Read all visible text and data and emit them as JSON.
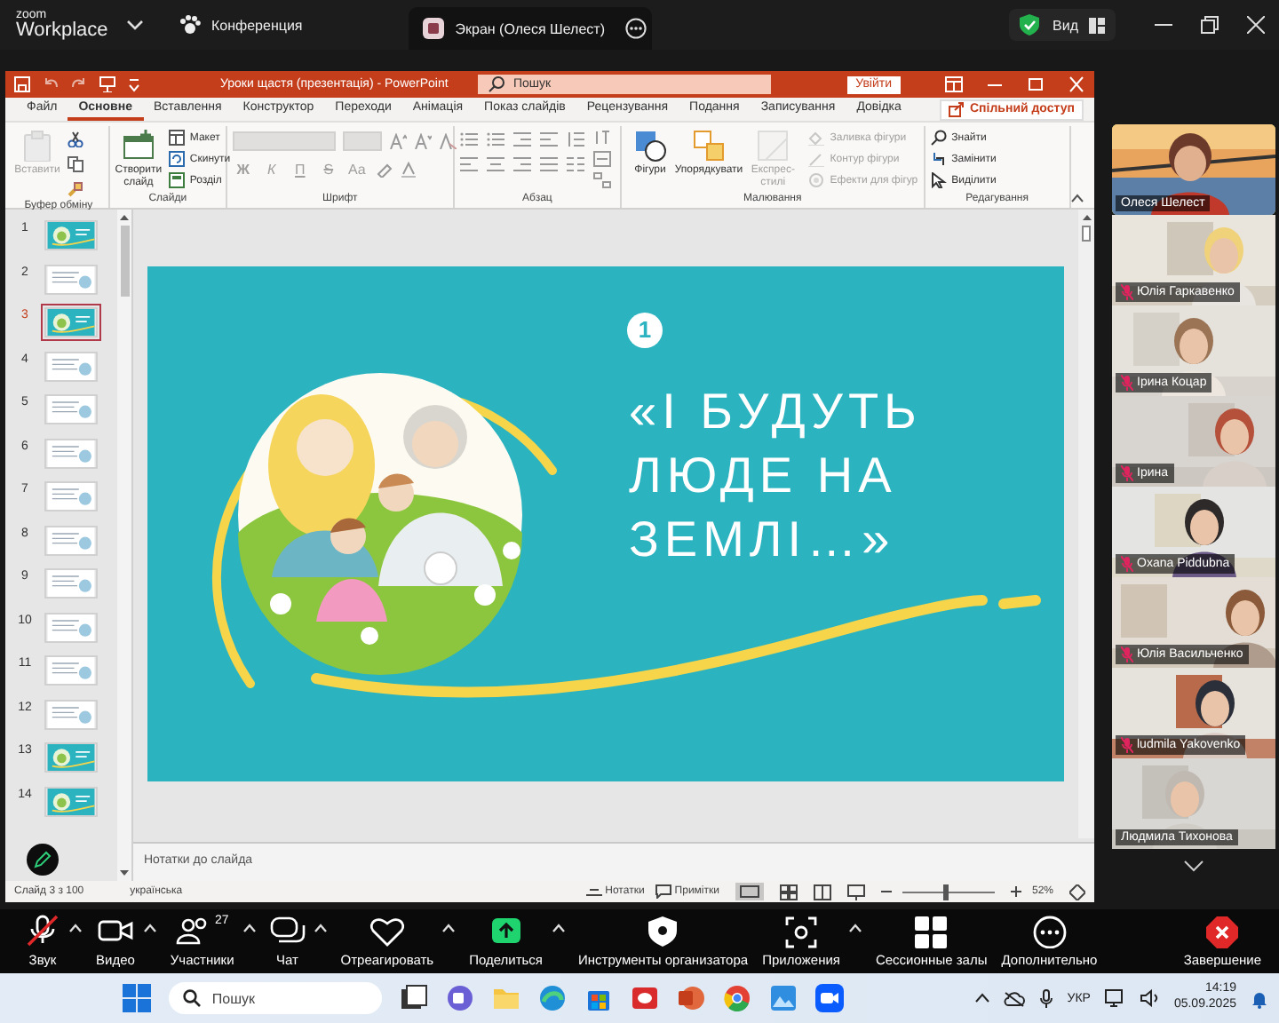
{
  "zoom_header": {
    "logo_top": "zoom",
    "logo_bottom": "Workplace",
    "meeting_tab": "Конференция",
    "share_tab": "Экран (Олеся Шелест)",
    "view_button": "Вид"
  },
  "powerpoint": {
    "title": "Уроки щастя (презентація)  -  PowerPoint",
    "search": {
      "placeholder": "Пошук"
    },
    "sign_in": "Увійти",
    "tabs": [
      {
        "label": "Файл",
        "selected": false
      },
      {
        "label": "Основне",
        "selected": true
      },
      {
        "label": "Вставлення",
        "selected": false
      },
      {
        "label": "Конструктор",
        "selected": false
      },
      {
        "label": "Переходи",
        "selected": false
      },
      {
        "label": "Анімація",
        "selected": false
      },
      {
        "label": "Показ слайдів",
        "selected": false
      },
      {
        "label": "Рецензування",
        "selected": false
      },
      {
        "label": "Подання",
        "selected": false
      },
      {
        "label": "Записування",
        "selected": false
      },
      {
        "label": "Довідка",
        "selected": false
      }
    ],
    "share_button": "Спільний доступ",
    "ribbon_groups": [
      {
        "label": "Буфер обміну",
        "buttons": [
          {
            "kind": "large",
            "label": "Вставити",
            "disabled": true
          }
        ]
      },
      {
        "label": "Слайди",
        "buttons": [
          {
            "kind": "large",
            "label": "Створити слайд",
            "disabled": false
          },
          {
            "kind": "small",
            "label": "Макет",
            "disabled": false
          },
          {
            "kind": "small",
            "label": "Скинути",
            "disabled": false
          },
          {
            "kind": "small",
            "label": "Розділ",
            "disabled": false
          }
        ]
      },
      {
        "label": "Шрифт",
        "buttons": [
          {
            "kind": "glyph",
            "label": "Ж",
            "disabled": true
          },
          {
            "kind": "glyph",
            "label": "К",
            "disabled": true
          },
          {
            "kind": "glyph",
            "label": "П",
            "disabled": true
          },
          {
            "kind": "glyph",
            "label": "S",
            "disabled": true
          },
          {
            "kind": "glyph",
            "label": "Aa",
            "disabled": true
          }
        ]
      },
      {
        "label": "Абзац"
      },
      {
        "label": "Малювання",
        "buttons": [
          {
            "kind": "large",
            "label": "Фігури",
            "disabled": false
          },
          {
            "kind": "large",
            "label": "Упорядкувати",
            "disabled": false
          },
          {
            "kind": "large",
            "label": "Експрес-стилі",
            "disabled": true
          },
          {
            "kind": "small",
            "label": "Заливка фігури",
            "disabled": true
          },
          {
            "kind": "small",
            "label": "Контур фігури",
            "disabled": true
          },
          {
            "kind": "small",
            "label": "Ефекти для фігур",
            "disabled": true
          }
        ]
      },
      {
        "label": "Редагування",
        "buttons": [
          {
            "kind": "small",
            "label": "Знайти",
            "disabled": false
          },
          {
            "kind": "small",
            "label": "Замінити",
            "disabled": false
          },
          {
            "kind": "small",
            "label": "Виділити",
            "disabled": false
          }
        ]
      }
    ],
    "thumbnails": [
      {
        "number": "1",
        "kind": "teal",
        "selected": false
      },
      {
        "number": "2",
        "kind": "light",
        "selected": false
      },
      {
        "number": "3",
        "kind": "teal",
        "selected": true
      },
      {
        "number": "4",
        "kind": "light",
        "selected": false
      },
      {
        "number": "5",
        "kind": "light",
        "selected": false
      },
      {
        "number": "6",
        "kind": "light",
        "selected": false
      },
      {
        "number": "7",
        "kind": "light",
        "selected": false
      },
      {
        "number": "8",
        "kind": "light",
        "selected": false
      },
      {
        "number": "9",
        "kind": "light",
        "selected": false
      },
      {
        "number": "10",
        "kind": "light",
        "selected": false
      },
      {
        "number": "11",
        "kind": "light",
        "selected": false
      },
      {
        "number": "12",
        "kind": "light",
        "selected": false
      },
      {
        "number": "13",
        "kind": "teal",
        "selected": false
      },
      {
        "number": "14",
        "kind": "teal",
        "selected": false
      }
    ],
    "slide": {
      "number": "1",
      "title": "«І БУДУТЬ ЛЮДЕ НА ЗЕМЛІ…»"
    },
    "notes": {
      "placeholder": "Нотатки до слайда"
    },
    "status_bar": {
      "slide_count": "Слайд 3 з 100",
      "language": "українська",
      "notes_button": "Нотатки",
      "comments_button": "Примітки",
      "zoom_slider": {
        "level": 0.45
      },
      "zoom_level": "52%"
    }
  },
  "participants": [
    {
      "name": "Олеся Шелест",
      "muted": false,
      "speaking": true
    },
    {
      "name": "Юлія Гаркавенко",
      "muted": true,
      "speaking": false
    },
    {
      "name": "Ірина Коцар",
      "muted": true,
      "speaking": false
    },
    {
      "name": "Ірина",
      "muted": true,
      "speaking": false
    },
    {
      "name": "Oxana Piddubna",
      "muted": true,
      "speaking": false
    },
    {
      "name": "Юлія Васильченко",
      "muted": true,
      "speaking": false
    },
    {
      "name": "ludmila Yakovenko",
      "muted": true,
      "speaking": false
    },
    {
      "name": "Людмила Тихонова",
      "muted": false,
      "speaking": false
    }
  ],
  "toolbar": [
    {
      "kind": "mic",
      "label": "Звук",
      "muted": true,
      "has_menu": true
    },
    {
      "kind": "video",
      "label": "Видео",
      "has_menu": true
    },
    {
      "kind": "participants",
      "label": "Участники",
      "count": "27",
      "has_menu": true
    },
    {
      "kind": "chat",
      "label": "Чат",
      "has_menu": true
    },
    {
      "kind": "react",
      "label": "Отреагировать",
      "has_menu": true
    },
    {
      "kind": "share",
      "label": "Поделиться",
      "has_menu": true
    },
    {
      "kind": "host",
      "label": "Инструменты организатора",
      "has_menu": false
    },
    {
      "kind": "apps",
      "label": "Приложения",
      "has_menu": true
    },
    {
      "kind": "breakout",
      "label": "Сессионные залы",
      "has_menu": false
    },
    {
      "kind": "more",
      "label": "Дополнительно",
      "has_menu": false
    },
    {
      "kind": "end",
      "label": "Завершение",
      "has_menu": false
    }
  ],
  "taskbar": {
    "search": {
      "placeholder": "Пошук"
    },
    "language": "УКР",
    "time": "14:19",
    "date": "05.09.2025"
  }
}
